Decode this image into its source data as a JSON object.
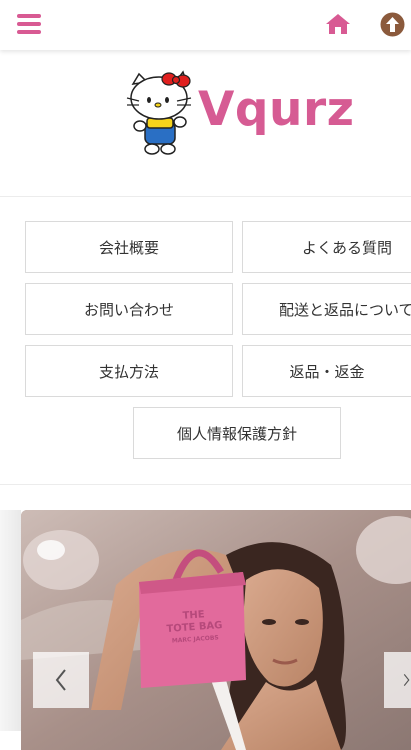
{
  "header": {
    "menu_icon": "hamburger-menu-icon",
    "home_icon": "home-icon",
    "up_icon": "arrow-up-circle-icon",
    "accent_color": "#d85a93",
    "up_icon_color": "#8b5a3c"
  },
  "logo": {
    "brand_name": "Vqurz",
    "mascot": "hello-kitty-mascot",
    "brand_color": "#d65b93"
  },
  "nav": {
    "items": [
      {
        "label": "会社概要"
      },
      {
        "label": "よくある質問"
      },
      {
        "label": "お問い合わせ"
      },
      {
        "label": "配送と返品について"
      },
      {
        "label": "支払方法"
      },
      {
        "label": "返品・返金"
      },
      {
        "label": "個人情報保護方針"
      }
    ]
  },
  "banner": {
    "bag_text_line1": "THE",
    "bag_text_line2": "TOTE BAG",
    "bag_text_line3": "MARC JACOBS",
    "prev_icon": "chevron-left-icon",
    "next_icon": "chevron-right-icon"
  }
}
